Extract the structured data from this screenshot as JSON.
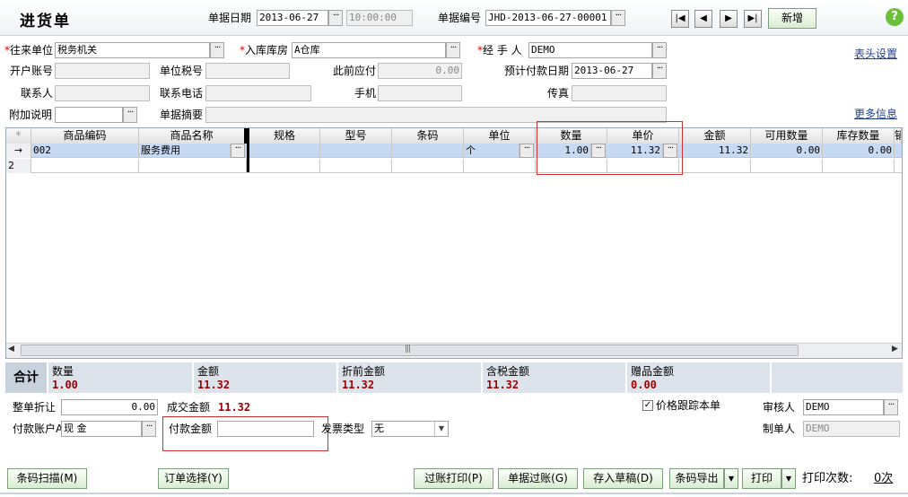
{
  "header": {
    "title": "进货单",
    "date_label": "单据日期",
    "date_value": "2013-06-27",
    "time_value": "10:00:00",
    "docno_label": "单据编号",
    "docno_value": "JHD-2013-06-27-00001",
    "new_button": "新增",
    "help_icon": "?"
  },
  "form": {
    "partner_label": "往来单位",
    "partner_value": "税务机关",
    "warehouse_label": "入库库房",
    "warehouse_value": "A仓库",
    "handler_label": "经 手 人",
    "handler_value": "DEMO",
    "header_settings": "表头设置",
    "bank_account_label": "开户账号",
    "tax_no_label": "单位税号",
    "prev_payable_label": "此前应付",
    "prev_payable_value": "0.00",
    "due_date_label": "预计付款日期",
    "due_date_value": "2013-06-27",
    "contact_label": "联系人",
    "phone_label": "联系电话",
    "mobile_label": "手机",
    "fax_label": "传真",
    "note_label": "附加说明",
    "summary_label": "单据摘要",
    "more_info": "更多信息",
    "required_mark": "*"
  },
  "grid": {
    "columns": [
      "*",
      "商品编码",
      "商品名称",
      "规格",
      "型号",
      "条码",
      "单位",
      "数量",
      "单价",
      "金额",
      "可用数量",
      "库存数量",
      "销"
    ],
    "rows": [
      {
        "marker": "→",
        "code": "002",
        "name": "服务费用",
        "spec": "",
        "model": "",
        "barcode": "",
        "unit": "个",
        "qty": "1.00",
        "price": "11.32",
        "amount": "11.32",
        "available": "0.00",
        "stock": "0.00"
      },
      {
        "marker": "2",
        "code": "",
        "name": "",
        "spec": "",
        "model": "",
        "barcode": "",
        "unit": "",
        "qty": "",
        "price": "",
        "amount": "",
        "available": "",
        "stock": ""
      }
    ],
    "scroll_grip": "|||"
  },
  "totals": {
    "label": "合计",
    "qty_label": "数量",
    "qty_value": "1.00",
    "amount_label": "金额",
    "amount_value": "11.32",
    "pre_discount_label": "折前金额",
    "pre_discount_value": "11.32",
    "tax_incl_label": "含税金额",
    "tax_incl_value": "11.32",
    "gift_label": "赠品金额",
    "gift_value": "0.00"
  },
  "footer": {
    "discount_label": "整单折让",
    "discount_value": "0.00",
    "deal_amount_label": "成交金额",
    "deal_amount_value": "11.32",
    "price_track_label": "价格跟踪本单",
    "auditor_label": "审核人",
    "auditor_value": "DEMO",
    "pay_account_label": "付款账户A",
    "pay_account_value": "现   金",
    "pay_amount_label": "付款金额",
    "invoice_type_label": "发票类型",
    "invoice_type_value": "无",
    "maker_label": "制单人",
    "maker_value": "DEMO"
  },
  "bottom_buttons": {
    "barcode_scan": "条码扫描(M)",
    "order_select": "订单选择(Y)",
    "post_print": "过账打印(P)",
    "post": "单据过账(G)",
    "save_draft": "存入草稿(D)",
    "barcode_export": "条码导出",
    "print": "打印",
    "print_count_label": "打印次数:",
    "print_count_value": "0次"
  },
  "colors": {
    "selected_row": "#c7daf3",
    "highlight_border": "#d03030",
    "totals_bg": "#dde3ea",
    "totals_value": "#a00000",
    "link": "#1f3f8f"
  }
}
